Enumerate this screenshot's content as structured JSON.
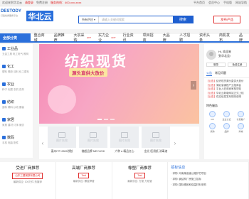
{
  "topbar": {
    "welcome": "欢迎来到华北云",
    "login": "请登录",
    "register": "免费注册",
    "hotline": "服务热线：400-xxx-xxxx",
    "links": [
      "平台首页",
      "会员中心",
      "手机版",
      "网站导航"
    ]
  },
  "header": {
    "logo_main": "DESTODY",
    "logo_sub": "打造优秀服务平台",
    "logo_brand": "华北云",
    "search_select": "所有供应",
    "search_placeholder": "请输入关键词搜索",
    "search_button": "搜索",
    "publish_button": "发布产品"
  },
  "nav": {
    "category_label": "全部分类",
    "items": [
      {
        "label": "整合商城",
        "hot": ""
      },
      {
        "label": "品牌推荐",
        "hot": ""
      },
      {
        "label": "大宗采购",
        "hot": "HOT"
      },
      {
        "label": "实力企业",
        "hot": "HOT"
      },
      {
        "label": "行业资讯",
        "hot": ""
      },
      {
        "label": "项目招商",
        "hot": ""
      },
      {
        "label": "大品牌",
        "hot": ""
      },
      {
        "label": "人才招聘",
        "hot": ""
      },
      {
        "label": "资讯头条",
        "hot": ""
      },
      {
        "label": "商机发布",
        "hot": ""
      },
      {
        "label": "品牌",
        "hot": ""
      }
    ]
  },
  "sidebar": {
    "groups": [
      {
        "title": "工业品",
        "sub": "五金工具 电工电气 照明"
      },
      {
        "title": "化工",
        "sub": "塑料 橡胶 涂料 化工原料"
      },
      {
        "title": "农业",
        "sub": "种子 化肥 农机 农药"
      },
      {
        "title": "纺织",
        "sub": "面料 辅料 纱线 服装"
      },
      {
        "title": "家居",
        "sub": "家具 建材 灯饰 家纺"
      },
      {
        "title": "数码",
        "sub": "手机 电脑 配件"
      }
    ]
  },
  "banner": {
    "title": "纺织现货",
    "subtitle": "源头直供大放价"
  },
  "thumbs": {
    "placeholder": "图片失效",
    "items": [
      {
        "caption": "泰州ITP-2800涂胶"
      },
      {
        "caption": "佛超品牌 MEYLEIK"
      },
      {
        "caption": "六种 ● 精品红心"
      },
      {
        "caption": "金光 医用纸 消毒液"
      }
    ]
  },
  "right": {
    "greeting": "Hi, 欢迎来",
    "uname": "到华北云!",
    "login": "登录",
    "register": "免费注册",
    "tabs": [
      "公告",
      "常见问题"
    ],
    "news": [
      {
        "tag": "【公告】",
        "text": "纺织现货源头直供大放价"
      },
      {
        "tag": "【公告】",
        "text": "湖北省钢铁产业招商会"
      },
      {
        "tag": "【公告】",
        "text": "平台入驻商家审核须知"
      },
      {
        "tag": "【公告】",
        "text": "华北云新版网站正式上线"
      },
      {
        "tag": "【公告】",
        "text": "供应信息发布规则说明"
      }
    ],
    "service_title": "特色服务",
    "services": [
      "VIP",
      "企业认证",
      "付费推广",
      "采购",
      "品牌",
      "商城"
    ]
  },
  "bottom": {
    "cols": [
      {
        "title": "受进厂商推荐",
        "tag": "山东三建钢铁有限公司",
        "line": "最新供应: 100万件 热镀锌"
      },
      {
        "title": "高端厂商推荐",
        "tag": "Test",
        "line": "最新供应: 螺旋焊管"
      },
      {
        "title": "橡塑厂商推荐",
        "tag": "Test",
        "line": "最新供应: 方管 方矩管"
      }
    ],
    "news_title": "招标信息",
    "news": [
      "· 求购: 河南某高速公路护栏项目",
      "· 求购: 钢结构厂房施工招标",
      "· 求购: 国际橡胶和保温材料采购"
    ]
  }
}
